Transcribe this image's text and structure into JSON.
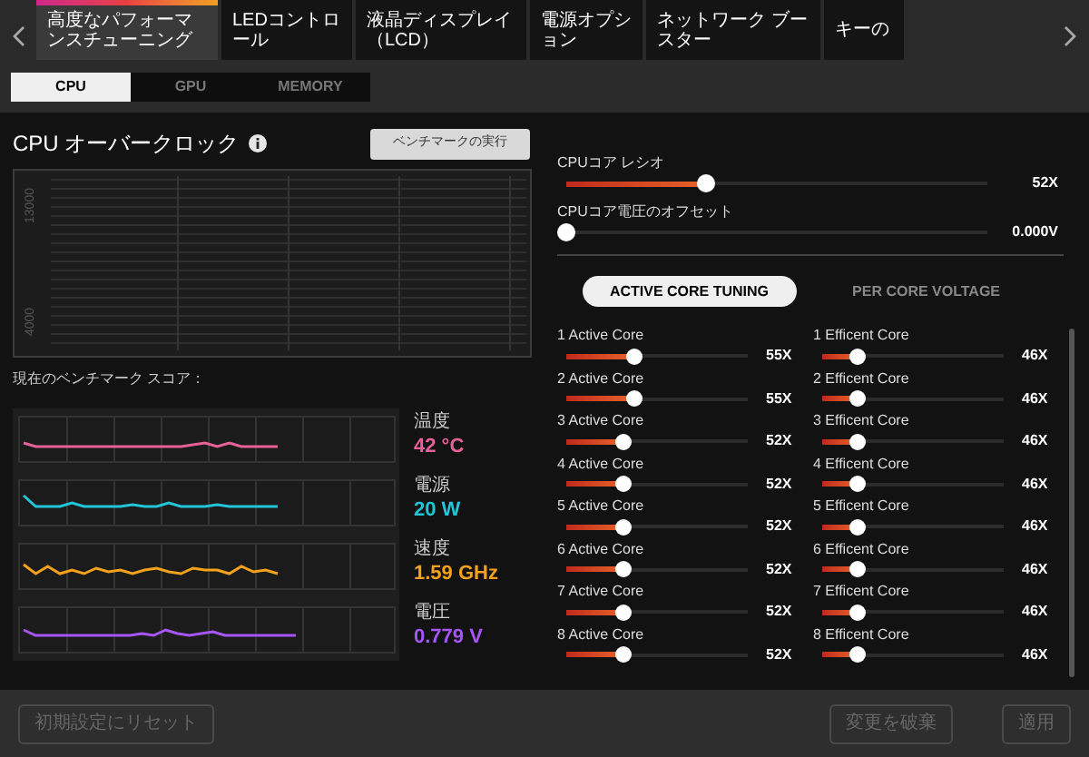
{
  "top_tabs": [
    {
      "label": "高度なパフォーマンスチューニング",
      "selected": true
    },
    {
      "label": "LEDコントロール",
      "selected": false
    },
    {
      "label": "液晶ディスプレイ（LCD）",
      "selected": false
    },
    {
      "label": "電源オプション",
      "selected": false
    },
    {
      "label": "ネットワーク ブースター",
      "selected": false
    },
    {
      "label": "キーの",
      "selected": false
    }
  ],
  "sub_tabs": [
    {
      "label": "CPU",
      "selected": true
    },
    {
      "label": "GPU",
      "selected": false
    },
    {
      "label": "MEMORY",
      "selected": false
    }
  ],
  "overclock": {
    "title": "CPU オーバークロック",
    "benchmark_button": "ベンチマークの実行",
    "y_tick_labels": [
      "13000",
      "4000"
    ],
    "score_label": "現在のベンチマーク スコア："
  },
  "metrics": [
    {
      "label": "温度",
      "value": "42 °C",
      "color": "#e8609a"
    },
    {
      "label": "電源",
      "value": "20 W",
      "color": "#22c5d8"
    },
    {
      "label": "速度",
      "value": "1.59 GHz",
      "color": "#f4a21c"
    },
    {
      "label": "電圧",
      "value": "0.779 V",
      "color": "#a855f7"
    }
  ],
  "main_sliders": [
    {
      "label": "CPUコア レシオ",
      "level": 0.33,
      "reading": "52X"
    },
    {
      "label": "CPUコア電圧のオフセット",
      "level": 0,
      "reading": "0.000V"
    }
  ],
  "mode_toggle": [
    {
      "label": "ACTIVE CORE TUNING",
      "selected": true
    },
    {
      "label": "PER CORE VOLTAGE",
      "selected": false
    }
  ],
  "active_cores": [
    {
      "label": "1 Active Core",
      "level": 0.38,
      "reading": "55X"
    },
    {
      "label": "2 Active Core",
      "level": 0.38,
      "reading": "55X"
    },
    {
      "label": "3 Active Core",
      "level": 0.32,
      "reading": "52X"
    },
    {
      "label": "4 Active Core",
      "level": 0.32,
      "reading": "52X"
    },
    {
      "label": "5 Active Core",
      "level": 0.32,
      "reading": "52X"
    },
    {
      "label": "6 Active Core",
      "level": 0.32,
      "reading": "52X"
    },
    {
      "label": "7 Active Core",
      "level": 0.32,
      "reading": "52X"
    },
    {
      "label": "8 Active Core",
      "level": 0.32,
      "reading": "52X"
    }
  ],
  "efficient_cores": [
    {
      "label": "1 Efficent Core",
      "level": 0.2,
      "reading": "46X"
    },
    {
      "label": "2 Efficent Core",
      "level": 0.2,
      "reading": "46X"
    },
    {
      "label": "3 Efficent Core",
      "level": 0.2,
      "reading": "46X"
    },
    {
      "label": "4 Efficent Core",
      "level": 0.2,
      "reading": "46X"
    },
    {
      "label": "5 Efficent Core",
      "level": 0.2,
      "reading": "46X"
    },
    {
      "label": "6 Efficent Core",
      "level": 0.2,
      "reading": "46X"
    },
    {
      "label": "7 Efficent Core",
      "level": 0.2,
      "reading": "46X"
    },
    {
      "label": "8 Efficent Core",
      "level": 0.2,
      "reading": "46X"
    }
  ],
  "footer": {
    "reset_button": {
      "label": "初期設定にリセット",
      "disabled": true
    },
    "discard_button": {
      "label": "変更を破棄",
      "disabled": true
    },
    "apply_button": {
      "label": "適用",
      "disabled": true
    }
  }
}
